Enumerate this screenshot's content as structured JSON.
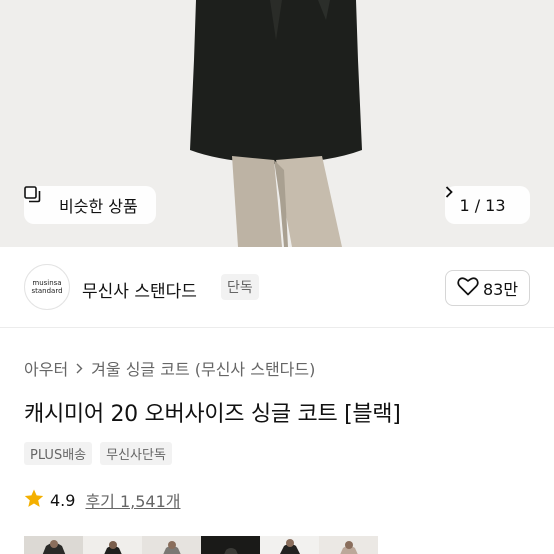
{
  "hero": {
    "similar_label": "비슷한 상품",
    "similar_icon": "similar-items-icon",
    "counter": "1 / 13",
    "next_icon": "chevron-right-icon"
  },
  "brand": {
    "logo_line1": "musinsa",
    "logo_line2": "standard",
    "name": "무신사 스탠다드",
    "badge": "단독",
    "like_icon": "heart-icon",
    "like_count": "83만"
  },
  "breadcrumb": {
    "category": "아우터",
    "separator_icon": "chevron-right-icon",
    "subcategory": "겨울 싱글 코트 (무신사 스탠다드)"
  },
  "product": {
    "title": "캐시미어 20 오버사이즈 싱글 코트 [블랙]",
    "tags": [
      "PLUS배송",
      "무신사단독"
    ]
  },
  "rating": {
    "star_icon": "star-icon",
    "star_color": "#f4b000",
    "score": "4.9",
    "reviews_label": "후기 1,541개"
  },
  "colors": {
    "text_primary": "#111111",
    "text_secondary": "#666666",
    "badge_bg": "#f2f2f2"
  }
}
